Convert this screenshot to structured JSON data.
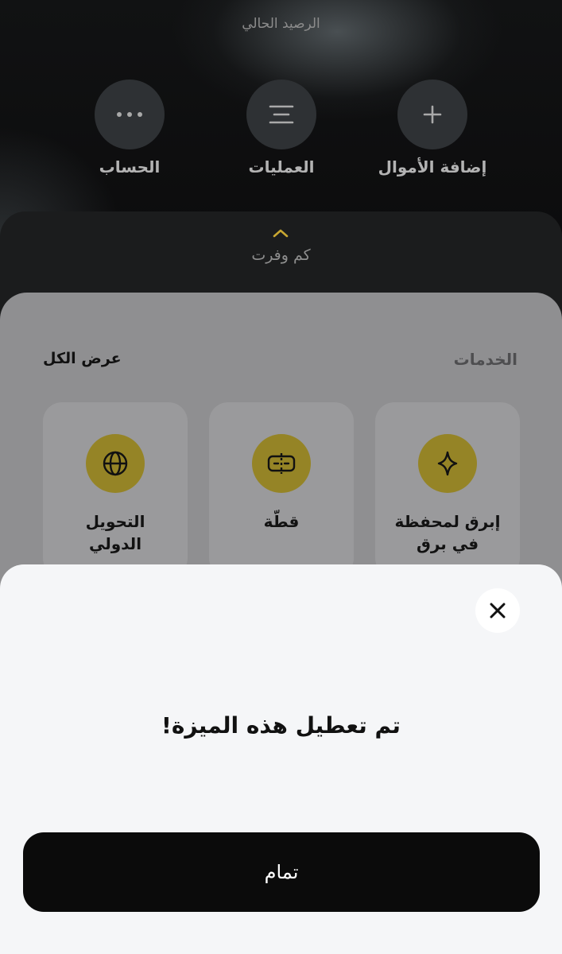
{
  "header": {
    "balance_label": "الرصيد الحالي"
  },
  "actions": [
    {
      "label": "إضافة الأموال",
      "icon": "plus-icon"
    },
    {
      "label": "العمليات",
      "icon": "menu-lines-icon"
    },
    {
      "label": "الحساب",
      "icon": "more-dots-icon"
    }
  ],
  "savings": {
    "label": "كم وفرت",
    "icon": "chevron-up-icon"
  },
  "services": {
    "title": "الخدمات",
    "view_all": "عرض الكل",
    "cards": [
      {
        "label_line1": "إبرق لمحفظة",
        "label_line2": "في برق",
        "icon": "sparkle-icon"
      },
      {
        "label_line1": "قطّة",
        "label_line2": "",
        "icon": "split-icon"
      },
      {
        "label_line1": "التحويل",
        "label_line2": "الدولي",
        "icon": "globe-icon"
      }
    ]
  },
  "dialog": {
    "message": "تم تعطيل هذه الميزة!",
    "ok_label": "تمام",
    "close_icon": "close-icon"
  },
  "colors": {
    "accent_gold": "#958426",
    "chevron_gold": "#c9a731",
    "dark": "#0b0b0b",
    "sheet_bg": "#f5f6f8"
  }
}
